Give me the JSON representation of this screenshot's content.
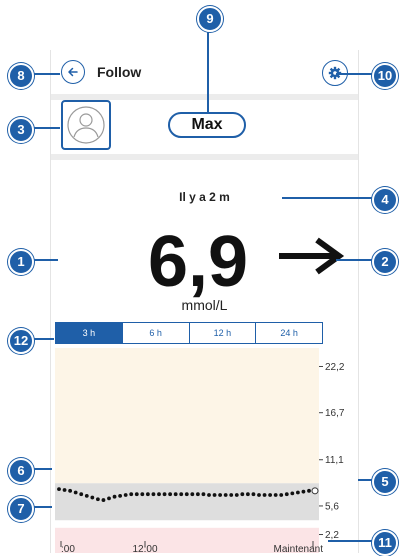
{
  "header": {
    "title": "Follow",
    "back_icon": "arrow-left-icon",
    "settings_icon": "gear-icon"
  },
  "profile": {
    "name": "Max",
    "avatar_icon": "user-avatar-icon"
  },
  "reading": {
    "since": "Il y a 2 m",
    "value": "6,9",
    "unit": "mmol/L",
    "trend_icon": "arrow-right-icon",
    "trend": "stable"
  },
  "tabs": [
    {
      "label": "3 h",
      "active": true
    },
    {
      "label": "6 h",
      "active": false
    },
    {
      "label": "12 h",
      "active": false
    },
    {
      "label": "24 h",
      "active": false
    }
  ],
  "chart_data": {
    "type": "scatter",
    "y_ticks": [
      "22,2",
      "16,7",
      "11,1",
      "5,6",
      "2,2"
    ],
    "y_values": [
      22.2,
      16.7,
      11.1,
      5.6,
      2.2
    ],
    "ylim": [
      0,
      24.4
    ],
    "x_ticks": [
      ":00",
      "12:00",
      "Maintenant"
    ],
    "bands": [
      {
        "name": "high",
        "from": 8.3,
        "to": 24.4,
        "color": "#fdf5e7"
      },
      {
        "name": "target",
        "from": 3.9,
        "to": 8.3,
        "color": "#dedede"
      },
      {
        "name": "low",
        "from": 0,
        "to": 3.0,
        "color": "#fbe4e6"
      }
    ],
    "series": [
      {
        "values": [
          7.6,
          7.5,
          7.4,
          7.2,
          7.0,
          6.8,
          6.6,
          6.4,
          6.3,
          6.5,
          6.7,
          6.8,
          6.9,
          7.0,
          7.0,
          7.0,
          7.0,
          7.0,
          7.0,
          7.0,
          7.0,
          7.0,
          7.0,
          7.0,
          7.0,
          7.0,
          7.0,
          6.9,
          6.9,
          6.9,
          6.9,
          6.9,
          6.9,
          7.0,
          7.0,
          7.0,
          6.9,
          6.9,
          6.9,
          6.9,
          6.9,
          7.0,
          7.1,
          7.2,
          7.3,
          7.4
        ]
      }
    ]
  },
  "callouts": [
    "1",
    "2",
    "3",
    "4",
    "5",
    "6",
    "7",
    "8",
    "9",
    "10",
    "11",
    "12"
  ],
  "colors": {
    "accent": "#1f5fa8",
    "high_band": "#fdf5e7",
    "target_band": "#dedede",
    "low_band": "#fbe4e6"
  }
}
